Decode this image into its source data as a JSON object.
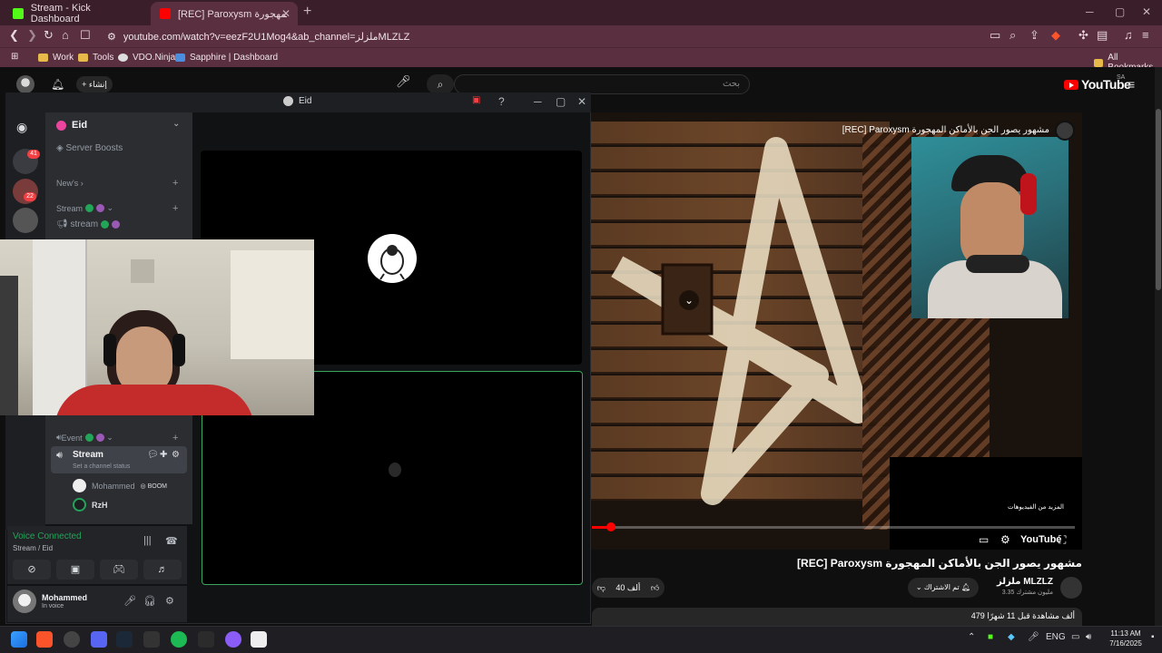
{
  "browser": {
    "tabs": [
      {
        "title": "Stream - Kick Dashboard"
      },
      {
        "title": "[REC] Paroxysm مشهور يصور الجن بالأماكن المهجورة"
      }
    ],
    "url": "youtube.com/watch?v=eezF2U1Mog4&ab_channel=ملزلزMLZLZ",
    "bookmarks": [
      "Work",
      "Tools",
      "VDO.Ninja",
      "Sapphire | Dashboard"
    ],
    "all_bookmarks": "All Bookmarks",
    "colors": {
      "chrome": "#5a2f40",
      "tabstrip": "#3a1f2b"
    }
  },
  "youtube": {
    "logo": "YouTube",
    "region": "SA",
    "search_placeholder": "بحث",
    "create_label": "إنشاء",
    "video_overlay_title": "[REC] Paroxysm مشهور يصور الجن بالأماكن المهجورة",
    "more_videos": "المزيد من الفيديوهات",
    "player_logo": "YouTube",
    "page_title": "[REC] Paroxysm مشهور يصور الجن بالأماكن المهجورة",
    "channel_name": "ملزلز MLZLZ",
    "subscribers": "3.35 مليون مشترك",
    "subscribe_label": "تم الاشتراك",
    "likes": "40 ألف",
    "views_line": "479 ألف مشاهدة قبل 11 شهرًا",
    "progress_fraction": 0.04
  },
  "discord": {
    "window_title": "Eid",
    "server_name": "Eid",
    "server_boosts": "Server Boosts",
    "categories": {
      "news": "New's",
      "stream": "Stream",
      "event": "Event"
    },
    "channels": {
      "stream_text": "stream",
      "voice": "Stream",
      "voice_status": "Set a channel status"
    },
    "members": [
      {
        "name": "Mohammed",
        "tag": "BOOM"
      },
      {
        "name": "RzH"
      }
    ],
    "badges": {
      "server1": "41",
      "server2": "22"
    },
    "voice_panel": {
      "status": "Voice Connected",
      "location": "Stream / Eid"
    },
    "user": {
      "name": "Mohammed",
      "status": "In voice"
    }
  },
  "taskbar": {
    "lang": "ENG",
    "time": "11:13 AM",
    "date": "7/16/2025"
  }
}
